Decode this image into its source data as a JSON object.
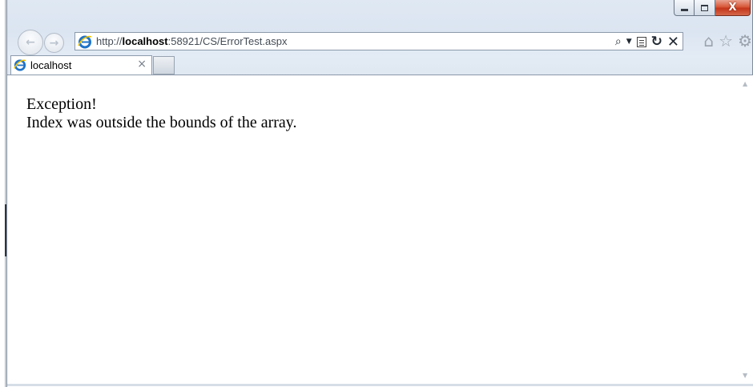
{
  "window": {
    "caption_buttons": {
      "minimize_icon": "minimize-icon",
      "maximize_icon": "maximize-icon",
      "close_glyph": "X"
    }
  },
  "nav": {
    "back_icon": "back-arrow-icon",
    "forward_icon": "forward-arrow-icon",
    "back_glyph": "←",
    "forward_glyph": "→"
  },
  "address": {
    "url_prefix": "http://",
    "url_host": "localhost",
    "url_rest": ":58921/CS/ErrorTest.aspx",
    "search_glyph": "⌕",
    "dropdown_glyph": "▼",
    "refresh_glyph": "↻",
    "stop_glyph": "✕"
  },
  "toolbar": {
    "home_glyph": "⌂",
    "favorites_glyph": "☆",
    "tools_glyph": "⚙"
  },
  "tab": {
    "title": "localhost",
    "close_glyph": "×"
  },
  "page": {
    "line1": "Exception!",
    "line2": "Index was outside the bounds of the array."
  },
  "colors": {
    "ie_blue": "#1e73c8",
    "ie_ring": "#f2c200",
    "close_red": "#c4361b"
  }
}
